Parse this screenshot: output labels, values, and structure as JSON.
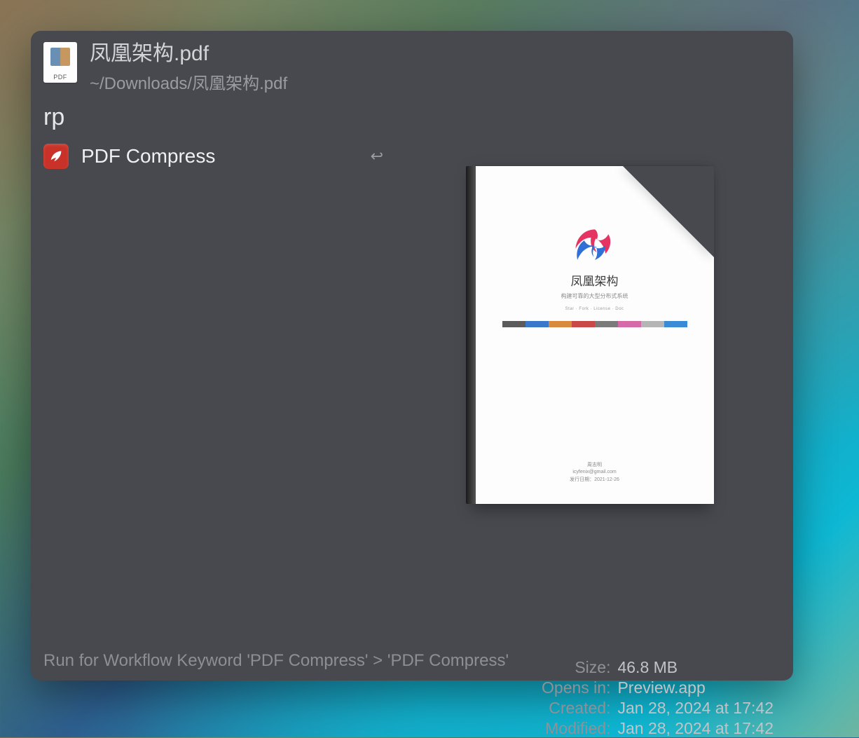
{
  "header": {
    "filename": "凤凰架构.pdf",
    "path": "~/Downloads/凤凰架构.pdf",
    "icon_label": "PDF"
  },
  "query": "rp",
  "results": [
    {
      "title": "PDF Compress",
      "return_glyph": "↩"
    }
  ],
  "preview": {
    "cover_title": "凤凰架构",
    "cover_subtitle": "构建可靠的大型分布式系统",
    "cover_badges": "Star · Fork · License · Doc",
    "cover_author": "周志明",
    "cover_email": "icyfenix@gmail.com",
    "cover_date": "发行日期：2021-12-26"
  },
  "meta": {
    "size_label": "Size:",
    "size_value": "46.8 MB",
    "opens_label": "Opens in:",
    "opens_value": "Preview.app",
    "created_label": "Created:",
    "created_value": "Jan 28, 2024 at 17:42",
    "modified_label": "Modified:",
    "modified_value": "Jan 28, 2024 at 17:42"
  },
  "footer_hint": "Run for Workflow Keyword 'PDF Compress' > 'PDF Compress'"
}
